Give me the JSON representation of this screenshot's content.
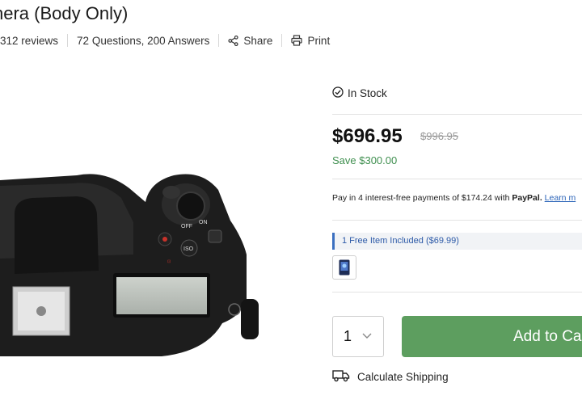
{
  "product": {
    "title": "nera (Body Only)",
    "reviews": "312 reviews",
    "qa": "72 Questions, 200 Answers",
    "share": "Share",
    "print": "Print"
  },
  "buybox": {
    "stock": "In Stock",
    "price": "$696.95",
    "old_price": "$996.95",
    "save": "Save $300.00",
    "paypal_prefix": "Pay in 4 interest-free payments of $174.24 with ",
    "paypal_brand": "PayPal.",
    "learn_more": "Learn m",
    "free_item": "1 Free Item Included ($69.99)",
    "quantity": "1",
    "add_to_cart": "Add to Ca",
    "shipping": "Calculate Shipping"
  },
  "colors": {
    "save_green": "#3f8f4f",
    "button_green": "#5d9e5f",
    "link_blue": "#2a63b8",
    "free_item_accent": "#3b6fc0"
  },
  "icons": [
    "check-circle-icon",
    "share-icon",
    "print-icon",
    "chevron-down-icon",
    "truck-icon"
  ]
}
